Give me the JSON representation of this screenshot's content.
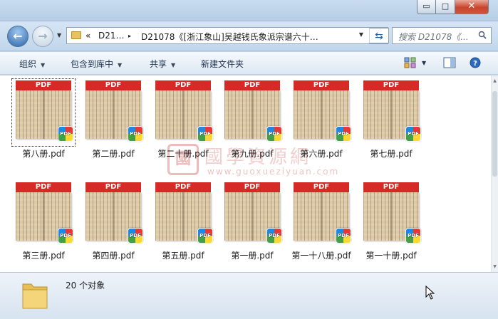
{
  "window": {
    "controls": {
      "minimize": "▭",
      "maximize": "□",
      "close": "✕"
    }
  },
  "address": {
    "crumb_prefix": "«",
    "crumb_parent": "D21…",
    "separator": "▸",
    "crumb_current": "D21078《[浙江象山]吴越钱氏象派宗谱六十…",
    "search_placeholder": "搜索 D21078《..."
  },
  "toolbar": {
    "organize": "组织",
    "include_in_library": "包含到库中",
    "share": "共享",
    "new_folder": "新建文件夹"
  },
  "files": [
    {
      "name": "第八册.pdf",
      "badge": "PDF",
      "selected": true
    },
    {
      "name": "第二册.pdf",
      "badge": "PDF"
    },
    {
      "name": "第二十册.pdf",
      "badge": "PDF"
    },
    {
      "name": "第九册.pdf",
      "badge": "PDF"
    },
    {
      "name": "第六册.pdf",
      "badge": "PDF"
    },
    {
      "name": "第七册.pdf",
      "badge": "PDF"
    },
    {
      "name": "第三册.pdf",
      "badge": "PDF"
    },
    {
      "name": "第四册.pdf",
      "badge": "PDF"
    },
    {
      "name": "第五册.pdf",
      "badge": "PDF"
    },
    {
      "name": "第一册.pdf",
      "badge": "PDF"
    },
    {
      "name": "第一十八册.pdf",
      "badge": "PDF"
    },
    {
      "name": "第一十册.pdf",
      "badge": "PDF"
    }
  ],
  "watermark": {
    "seal": "國",
    "title": "國學資源網",
    "url": "www.guoxueziyuan.com"
  },
  "status": {
    "count_text": "20 个对象"
  },
  "colors": {
    "pdf_red": "#d52a25",
    "window_frame": "#bcd3ea"
  }
}
